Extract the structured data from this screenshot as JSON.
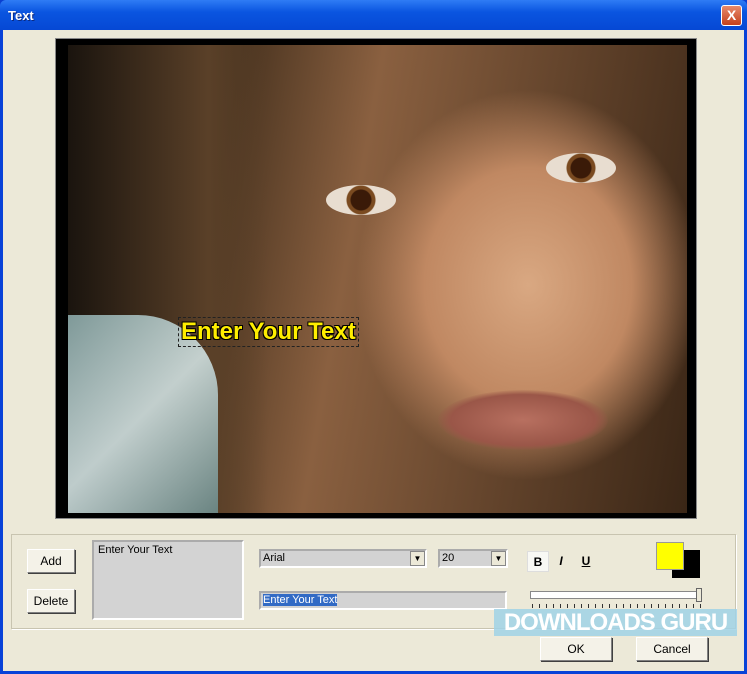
{
  "window": {
    "title": "Text",
    "close_glyph": "X"
  },
  "preview": {
    "overlay_text": "Enter Your Text",
    "text_color": "#ffee00"
  },
  "controls": {
    "add_label": "Add",
    "delete_label": "Delete",
    "text_list": [
      "Enter Your Text"
    ],
    "font": "Arial",
    "size": "20",
    "text_value": "Enter Your Text",
    "bold_label": "B",
    "italic_label": "I",
    "underline_label": "U",
    "foreground_color": "#ffff00",
    "background_color": "#000000",
    "slider_value": 1.0
  },
  "footer": {
    "ok_label": "OK",
    "cancel_label": "Cancel"
  },
  "watermark": "DOWNLOADS GURU"
}
